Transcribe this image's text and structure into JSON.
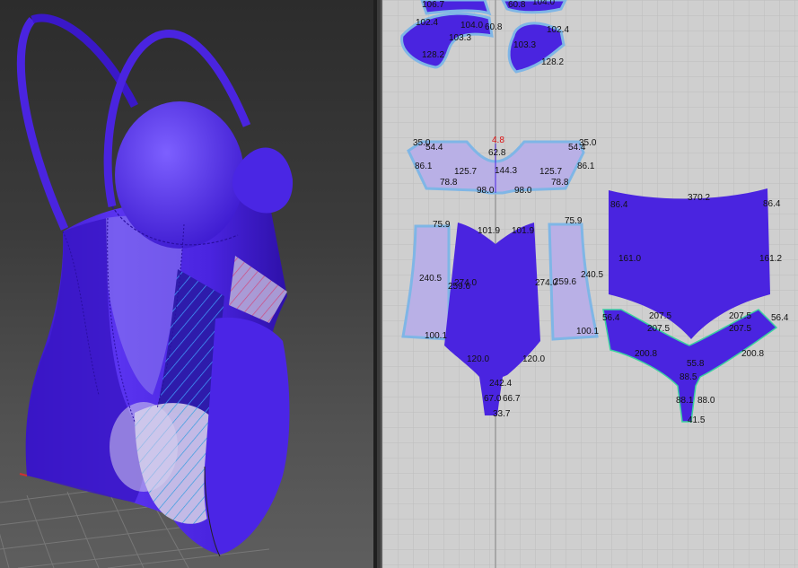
{
  "colors": {
    "fabric": "#4a24e0",
    "fabric_light": "#b9b0e6",
    "outline": "#7fb6e6",
    "grid_bg": "#cfcfcf",
    "measure_red": "#d11111"
  },
  "viewport_3d": {
    "name": "3D garment viewport"
  },
  "pattern_window": {
    "labels": {
      "top_a1": "106.7",
      "top_a2": "102.4",
      "top_a3": "104.0",
      "top_a4": "60.8",
      "top_a5": "103.3",
      "top_a6": "128.2",
      "top_b1": "60.8",
      "top_b2": "104.0",
      "top_b3": "102.4",
      "top_b4": "103.3",
      "top_b5": "128.2",
      "band_1": "35.0",
      "band_2": "54.4",
      "band_3": "86.1",
      "band_4": "125.7",
      "band_5": "78.8",
      "band_6": "98.0",
      "band_7": "62.8",
      "band_8": "144.3",
      "band_9": "4.8",
      "band_10": "98.0",
      "band_11": "78.8",
      "band_12": "125.7",
      "band_13": "86.1",
      "band_14": "54.4",
      "band_15": "35.0",
      "side_l1": "75.9",
      "side_l2": "240.5",
      "side_l3": "100.1",
      "side_l4": "274.0",
      "side_l5": "259.6",
      "front_1": "101.9",
      "front_2": "101.9",
      "front_3": "120.0",
      "front_4": "120.0",
      "front_5": "242.4",
      "front_6": "67.0",
      "front_7": "66.7",
      "front_8": "33.7",
      "side_r1": "75.9",
      "side_r2": "259.6",
      "side_r3": "240.5",
      "side_r4": "274.0",
      "side_r5": "100.1",
      "back_1": "370.2",
      "back_2": "86.4",
      "back_3": "86.4",
      "back_4": "161.0",
      "back_5": "161.2",
      "back_6": "207.5",
      "back_7": "207.5",
      "back_8": "56.4",
      "back_9": "56.4",
      "back_10": "207.5",
      "back_11": "207.5",
      "back_12": "200.8",
      "back_13": "200.8",
      "back_14": "55.8",
      "back_15": "88.5",
      "back_16": "88.1",
      "back_17": "88.0",
      "back_18": "41.5"
    }
  }
}
